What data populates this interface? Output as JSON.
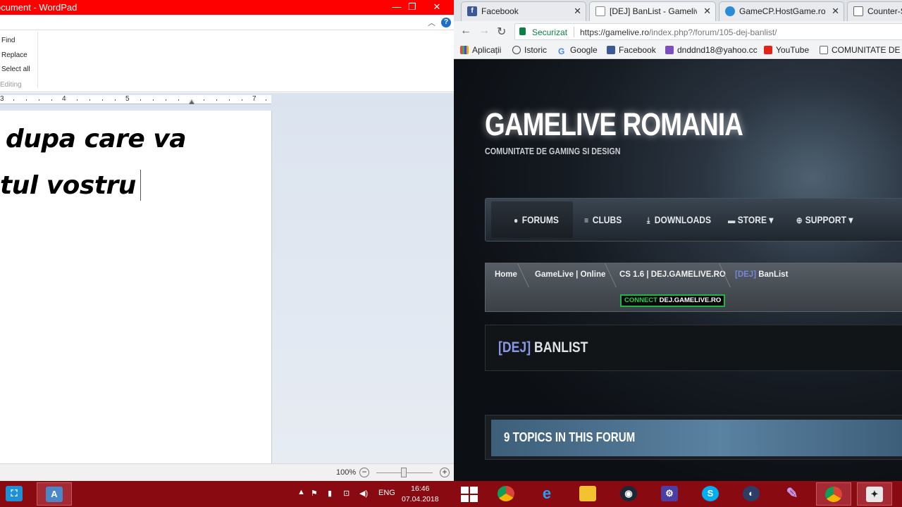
{
  "wordpad": {
    "title": "ocument - WordPad",
    "window_controls": [
      "—",
      "❐",
      "✕"
    ],
    "editing_commands": [
      "Find",
      "Replace",
      "Select all"
    ],
    "editing_group_label": "Editing",
    "ruler_numbers": [
      "3",
      "4",
      "5",
      "7"
    ],
    "lines": [
      "dupa care va",
      "tul vostru"
    ],
    "zoom": "100%"
  },
  "browser": {
    "tabs": [
      {
        "label": "Facebook",
        "active": false
      },
      {
        "label": "[DEJ] BanList - Gamelive",
        "active": true
      },
      {
        "label": "GameCP.HostGame.ro -",
        "active": false
      },
      {
        "label": "Counter-St",
        "active": false
      }
    ],
    "security_label": "Securizat",
    "url_base": "https://gamelive.ro",
    "url_path": "/index.php?/forum/105-dej-banlist/",
    "bookmarks": [
      "Aplicații",
      "Istoric",
      "Google",
      "Facebook",
      "dnddnd18@yahoo.cc",
      "YouTube",
      "COMUNITATE DE G"
    ]
  },
  "site": {
    "title": "GAMELIVE ROMANIA",
    "subtitle": "COMUNITATE DE GAMING SI DESIGN",
    "nav": [
      "FORUMS",
      "CLUBS",
      "DOWNLOADS",
      "STORE",
      "SUPPORT"
    ],
    "breadcrumbs": [
      "Home",
      "GameLive | Online",
      "CS 1.6 | DEJ.GAMELIVE.RO"
    ],
    "breadcrumb_current_tag": "[DEJ]",
    "breadcrumb_current": "BanList",
    "connect_prefix": "CONNECT",
    "connect_host": "DEJ.GAMELIVE.RO",
    "forum_tag": "[DEJ]",
    "forum_title": "BANLIST",
    "topics_header": "9 TOPICS IN THIS FORUM"
  },
  "taskbar": {
    "language": "ENG",
    "time": "16:46",
    "date": "07.04.2018"
  },
  "colors": {
    "wordpad_titlebar": "#ff0000",
    "taskbar": "#8a0a12",
    "secure_green": "#0b8043",
    "tag_blue": "#8a97e8",
    "connect_green": "#27d052"
  }
}
